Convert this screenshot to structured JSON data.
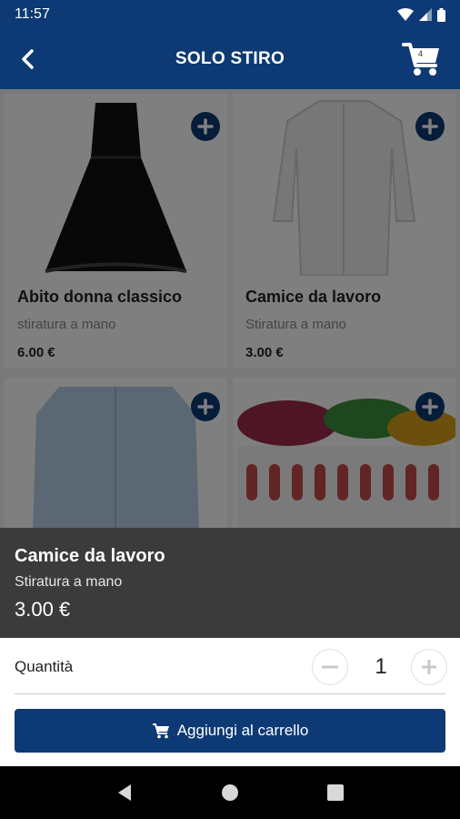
{
  "status_bar": {
    "time": "11:57"
  },
  "app_bar": {
    "title": "SOLO STIRO",
    "cart_count": "4"
  },
  "products": [
    {
      "name": "Abito donna classico",
      "subtitle": "stiratura a mano",
      "price": "6.00 €"
    },
    {
      "name": "Camice da lavoro",
      "subtitle": "Stiratura a mano",
      "price": "3.00 €"
    },
    {
      "name": "",
      "subtitle": "",
      "price": ""
    },
    {
      "name": "",
      "subtitle": "",
      "price": ""
    }
  ],
  "sheet": {
    "title": "Camice da lavoro",
    "subtitle": "Stiratura a mano",
    "price": "3.00 €",
    "quantity_label": "Quantità",
    "quantity": "1",
    "add_to_cart_label": "Aggiungi al carrello"
  },
  "colors": {
    "brand": "#0d3a74",
    "sheet_header": "#3b3b3b"
  }
}
